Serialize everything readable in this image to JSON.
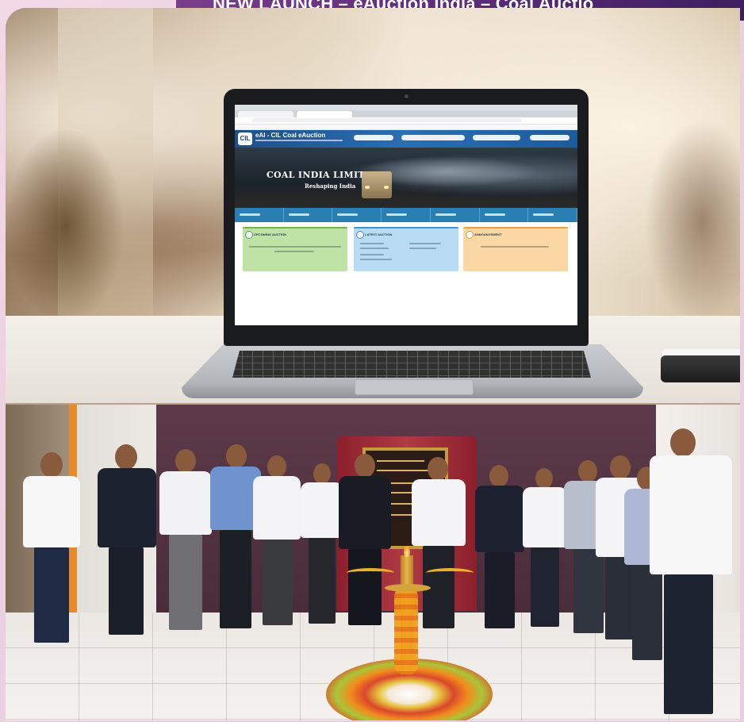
{
  "banner": {
    "text": "NEW LAUNCH – eAuction India – Coal Auctio"
  },
  "laptop_screen": {
    "site_logo": "CIL",
    "site_title": "eAI - CIL Coal eAuction",
    "hero_title": "COAL INDIA LIMITED",
    "hero_tagline": "Reshaping India",
    "cards": [
      {
        "label": "UPCOMING AUCTION"
      },
      {
        "label": "LATEST AUCTION"
      },
      {
        "label": "ANNOUNCEMENT"
      }
    ]
  },
  "colors": {
    "banner": "#5a2a78",
    "site_header": "#2a6fb3",
    "nav": "#2a7fb2",
    "wall": "#4a2c3b",
    "curtain": "#b03a45"
  },
  "icons": [
    "laptop",
    "lamp",
    "plaque",
    "rangoli"
  ]
}
